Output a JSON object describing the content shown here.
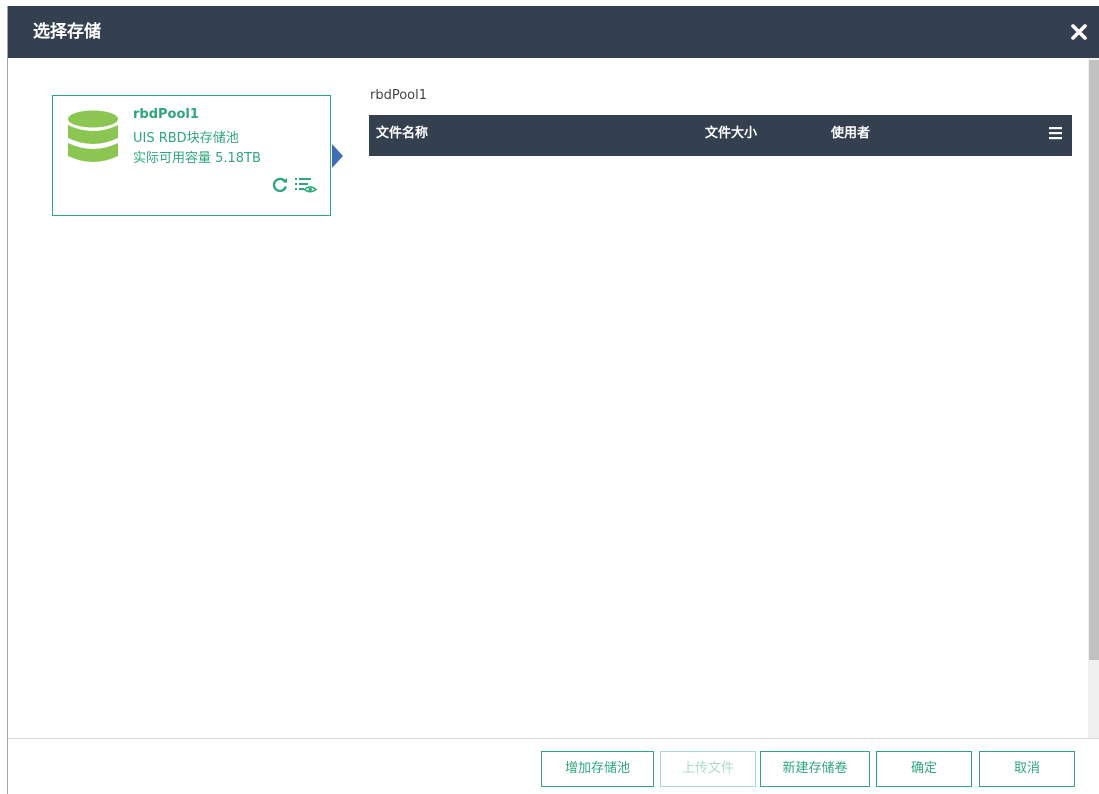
{
  "dialog": {
    "title": "选择存储"
  },
  "pool_card": {
    "name": "rbdPool1",
    "type": "UIS RBD块存储池",
    "capacity": "实际可用容量 5.18TB",
    "accent_color": "#2fa77a",
    "icon_color": "#8bc653"
  },
  "breadcrumb": "rbdPool1",
  "table": {
    "columns": [
      "文件名称",
      "文件大小",
      "使用者"
    ],
    "rows": []
  },
  "buttons": {
    "add_pool": "增加存储池",
    "upload_file": "上传文件",
    "new_volume": "新建存储卷",
    "ok": "确定",
    "cancel": "取消"
  },
  "colors": {
    "header_bg": "#343f50",
    "accent": "#2fa77a",
    "pointer": "#3f6db6"
  }
}
